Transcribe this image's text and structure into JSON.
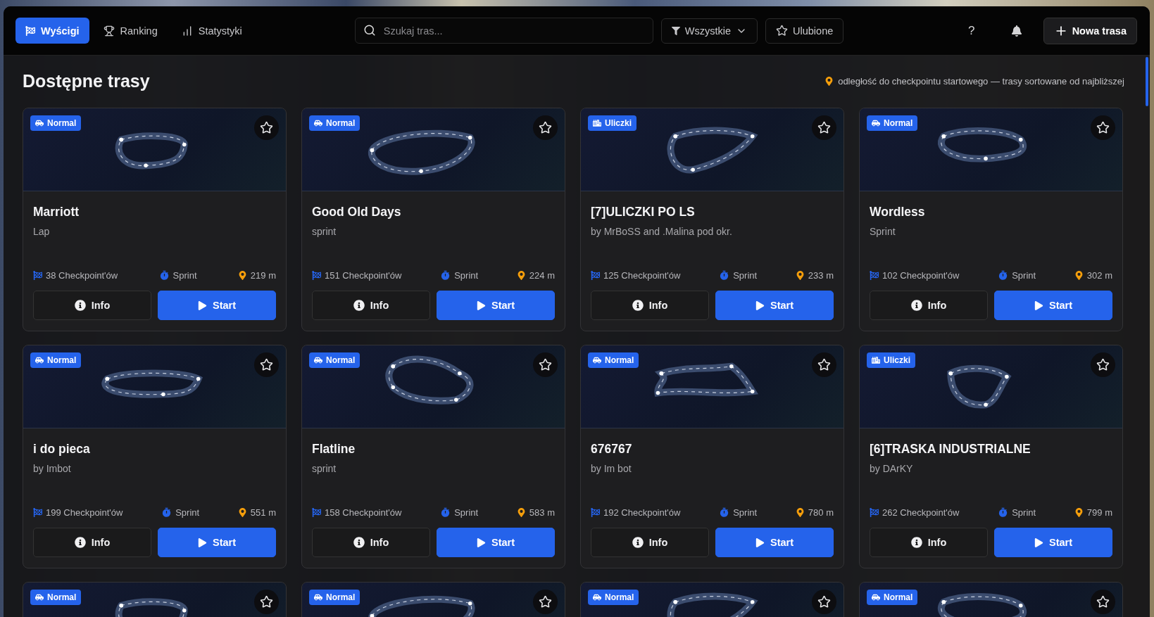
{
  "nav": {
    "tabs": [
      {
        "label": "Wyścigi",
        "kind": "races",
        "selected": true
      },
      {
        "label": "Ranking",
        "kind": "ranking",
        "selected": false
      },
      {
        "label": "Statystyki",
        "kind": "stats",
        "selected": false
      }
    ],
    "search": {
      "placeholder": "Szukaj tras..."
    },
    "filter": {
      "label": "Wszystkie"
    },
    "favorites": {
      "label": "Ulubione"
    },
    "help_label": "?",
    "new_button": {
      "label": "Nowa trasa"
    }
  },
  "heading": {
    "title": "Dostępne trasy",
    "note": "odległość do checkpointu startowego — trasy sortowane od najbliższej"
  },
  "cards": [
    {
      "badge": {
        "label": "Normal",
        "kind": "normal"
      },
      "favorite": false,
      "title": "Marriott",
      "subtitle": "Lap",
      "checkpoints": "38 Checkpoint'ów",
      "mode": "Sprint",
      "distance": "219 m",
      "info": "Info",
      "start": "Start"
    },
    {
      "badge": {
        "label": "Normal",
        "kind": "normal"
      },
      "favorite": false,
      "title": "Good Old Days",
      "subtitle": "sprint",
      "checkpoints": "151 Checkpoint'ów",
      "mode": "Sprint",
      "distance": "224 m",
      "info": "Info",
      "start": "Start"
    },
    {
      "badge": {
        "label": "Uliczki",
        "kind": "street"
      },
      "favorite": false,
      "title": "[7]ULICZKI PO LS",
      "subtitle": "by MrBoSS and .Malina pod okr.",
      "checkpoints": "125 Checkpoint'ów",
      "mode": "Sprint",
      "distance": "233 m",
      "info": "Info",
      "start": "Start"
    },
    {
      "badge": {
        "label": "Normal",
        "kind": "normal"
      },
      "favorite": false,
      "title": "Wordless",
      "subtitle": "Sprint",
      "checkpoints": "102 Checkpoint'ów",
      "mode": "Sprint",
      "distance": "302 m",
      "info": "Info",
      "start": "Start"
    },
    {
      "badge": {
        "label": "Normal",
        "kind": "normal"
      },
      "favorite": false,
      "title": "i do pieca",
      "subtitle": "by Imbot",
      "checkpoints": "199 Checkpoint'ów",
      "mode": "Sprint",
      "distance": "551 m",
      "info": "Info",
      "start": "Start"
    },
    {
      "badge": {
        "label": "Normal",
        "kind": "normal"
      },
      "favorite": false,
      "title": "Flatline",
      "subtitle": "sprint",
      "checkpoints": "158 Checkpoint'ów",
      "mode": "Sprint",
      "distance": "583 m",
      "info": "Info",
      "start": "Start"
    },
    {
      "badge": {
        "label": "Normal",
        "kind": "normal"
      },
      "favorite": false,
      "title": "676767",
      "subtitle": "by Im bot",
      "checkpoints": "192 Checkpoint'ów",
      "mode": "Sprint",
      "distance": "780 m",
      "info": "Info",
      "start": "Start"
    },
    {
      "badge": {
        "label": "Uliczki",
        "kind": "street"
      },
      "favorite": false,
      "title": "[6]TRASKA INDUSTRIALNE",
      "subtitle": "by DArKY",
      "checkpoints": "262 Checkpoint'ów",
      "mode": "Sprint",
      "distance": "799 m",
      "info": "Info",
      "start": "Start"
    },
    {
      "badge": {
        "label": "Normal",
        "kind": "normal"
      },
      "favorite": false
    },
    {
      "badge": {
        "label": "Normal",
        "kind": "normal"
      },
      "favorite": false
    },
    {
      "badge": {
        "label": "Normal",
        "kind": "normal"
      },
      "favorite": false
    },
    {
      "badge": {
        "label": "Normal",
        "kind": "normal"
      },
      "favorite": false
    }
  ]
}
